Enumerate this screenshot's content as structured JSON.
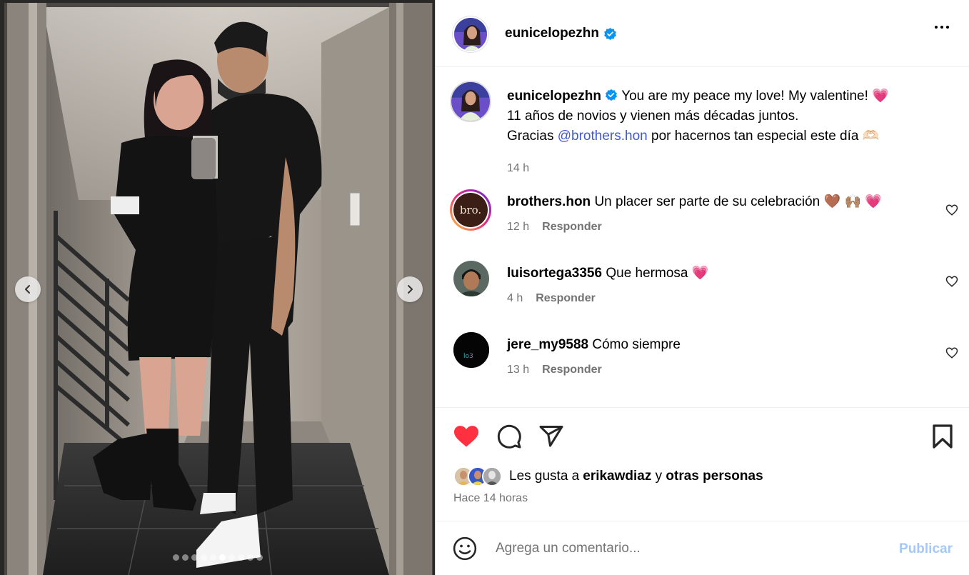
{
  "post": {
    "username": "eunicelopezhn",
    "verified_icon": "verified-badge-icon",
    "more_icon": "more-options-icon"
  },
  "photo": {
    "prev_icon": "chevron-left-icon",
    "next_icon": "chevron-right-icon",
    "slide_count": 10,
    "active_slide": 6
  },
  "caption": {
    "username": "eunicelopezhn",
    "line1": "You are my peace my love! My valentine! 💗",
    "line2": "11 años de novios y vienen más décadas juntos.",
    "line3_before": "Gracias ",
    "mention": "@brothers.hon",
    "line3_after": " por hacernos tan especial este día 🫶🏻",
    "time": "14 h"
  },
  "comments": [
    {
      "username": "brothers.hon",
      "text": "Un placer ser parte de su celebración 🤎 🙌🏽 💗",
      "time": "12 h",
      "reply": "Responder",
      "avatar_text": "bro."
    },
    {
      "username": "luisortega3356",
      "text": "Que hermosa 💗",
      "time": "4 h",
      "reply": "Responder"
    },
    {
      "username": "jere_my9588",
      "text": "Cómo siempre",
      "time": "13 h",
      "reply": "Responder"
    }
  ],
  "actions": {
    "like_icon": "heart-filled-icon",
    "comment_icon": "comment-icon",
    "share_icon": "share-icon",
    "save_icon": "bookmark-icon",
    "like_color": "#ff3040"
  },
  "likes": {
    "prefix": "Les gusta a ",
    "user": "erikawdiaz",
    "middle": " y ",
    "others": "otras personas"
  },
  "time_ago": "Hace 14 horas",
  "comment_input": {
    "placeholder": "Agrega un comentario...",
    "emoji_icon": "emoji-smiley-icon",
    "publish_label": "Publicar"
  },
  "colors": {
    "link": "#4458d6",
    "publish_disabled": "#a5c8f9",
    "secondary_text": "#737373"
  }
}
